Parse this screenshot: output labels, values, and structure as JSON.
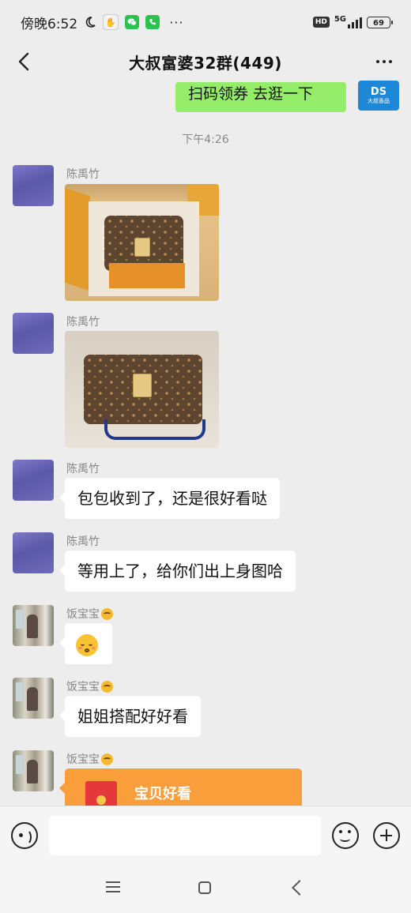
{
  "status_bar": {
    "time": "傍晚6:52",
    "network": "5G",
    "battery": "69",
    "hd_label": "HD"
  },
  "header": {
    "title": "大叔富婆32群(449)"
  },
  "messages": {
    "self_message": "扫码领券 去逛一下",
    "self_avatar_text": "大叔香品",
    "timestamp": "下午4:26",
    "m1": {
      "sender": "陈禹竹"
    },
    "m2": {
      "sender": "陈禹竹"
    },
    "m3": {
      "sender": "陈禹竹",
      "text": "包包收到了，还是很好看哒"
    },
    "m4": {
      "sender": "陈禹竹",
      "text": "等用上了，给你们出上身图哈"
    },
    "m5": {
      "sender": "饭宝宝"
    },
    "m6": {
      "sender": "饭宝宝",
      "text": "姐姐搭配好好看"
    },
    "m7": {
      "sender": "饭宝宝",
      "redpacket_text": "宝贝好看"
    }
  },
  "input_bar": {
    "placeholder": ""
  },
  "colors": {
    "self_bubble": "#95ec69",
    "background": "#ededed",
    "redpacket": "#fa9d3b"
  }
}
